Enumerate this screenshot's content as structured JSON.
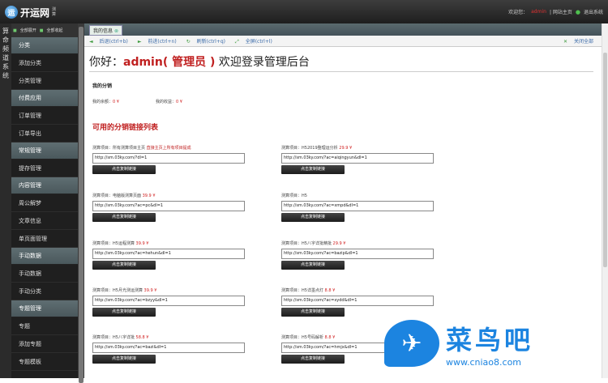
{
  "header": {
    "logo_text": "开运网",
    "logo_sub": "测算",
    "welcome": "欢迎您：",
    "username": "admin",
    "home_link": "| 网站主页",
    "exit_link": "退出系统"
  },
  "leftstrip": {
    "text": "算命频道系统"
  },
  "sidebar": {
    "expand_all": "全部展开",
    "collapse_all": "全部收起",
    "items": [
      {
        "type": "head",
        "label": "分类"
      },
      {
        "type": "item",
        "label": "添加分类"
      },
      {
        "type": "item",
        "label": "分类管理"
      },
      {
        "type": "head",
        "label": "付费应用"
      },
      {
        "type": "item",
        "label": "订单管理"
      },
      {
        "type": "item",
        "label": "订单导出"
      },
      {
        "type": "head",
        "label": "常规管理"
      },
      {
        "type": "item",
        "label": "提存管理"
      },
      {
        "type": "head",
        "label": "内容管理"
      },
      {
        "type": "item",
        "label": "周公解梦"
      },
      {
        "type": "item",
        "label": "文章信息"
      },
      {
        "type": "item",
        "label": "单页面管理"
      },
      {
        "type": "head",
        "label": "手动数据"
      },
      {
        "type": "item",
        "label": "手动数据"
      },
      {
        "type": "item",
        "label": "手动分类"
      },
      {
        "type": "head",
        "label": "专题管理"
      },
      {
        "type": "item",
        "label": "专题"
      },
      {
        "type": "item",
        "label": "添加专题"
      },
      {
        "type": "item",
        "label": "专题模板"
      }
    ]
  },
  "tabs": {
    "active": "我的信息"
  },
  "nav": {
    "back": "后退(ctrl+b)",
    "forward": "前进(ctrl+n)",
    "refresh": "刷新(ctrl+q)",
    "fullscreen": "全屏(ctrl+l)",
    "close_all": "关闭全部"
  },
  "main": {
    "greeting_pre": "你好：",
    "greeting_name": "admin( 管理员 )",
    "greeting_post": "欢迎登录管理后台",
    "my_share": "我的分销",
    "balance_label": "我的余额：",
    "balance_value": "0 ¥",
    "income_label": "我的收益：",
    "income_value": "0 ¥",
    "list_title": "可用的分销链接列表",
    "button_label": "点击复制链接",
    "items": [
      {
        "label": "测算项目：所有测算项目主页",
        "price": "",
        "note": "直接主页上所有项目提成",
        "url": "http://sm.03ky.com/?dl=1"
      },
      {
        "label": "测算项目：H52019整理运分析",
        "price": "29.9 ¥",
        "note": "",
        "url": "http://sm.03ky.com/?ac=aiqingyun&dl=1"
      },
      {
        "label": "测算项目：电脑版测算页面",
        "price": "39.9 ¥",
        "note": "",
        "url": "http://sm.03ky.com/?ac=pc&dl=1"
      },
      {
        "label": "测算项目：H5",
        "price": "",
        "note": "",
        "url": "http://sm.03ky.com/?ac=xmpd&dl=1"
      },
      {
        "label": "测算项目：H5运程测算",
        "price": "39.9 ¥",
        "note": "",
        "url": "http://sm.03ky.com/?ac=hehun&dl=1"
      },
      {
        "label": "测算项目：H5八字详批精批",
        "price": "29.9 ¥",
        "note": "",
        "url": "http://sm.03ky.com/?ac=bazip&dl=1"
      },
      {
        "label": "测算项目：H5月光测运测算",
        "price": "39.9 ¥",
        "note": "",
        "url": "http://sm.03ky.com/?ac=bzyy&dl=1"
      },
      {
        "label": "测算项目：H5详墨点灯",
        "price": "8.8 ¥",
        "note": "",
        "url": "http://sm.03ky.com/?ac=xydd&dl=1"
      },
      {
        "label": "测算项目：H5八字详批",
        "price": "58.8 ¥",
        "note": "",
        "url": "http://sm.03ky.com/?ac=bazi&dl=1"
      },
      {
        "label": "测算项目：H5号码解析",
        "price": "8.8 ¥",
        "note": "",
        "url": "http://sm.03ky.com/?ac=hmjx&dl=1"
      }
    ]
  },
  "watermark": {
    "cn": "菜鸟吧",
    "url": "www.cniao8.com",
    "bird_icon": "bird-icon"
  }
}
